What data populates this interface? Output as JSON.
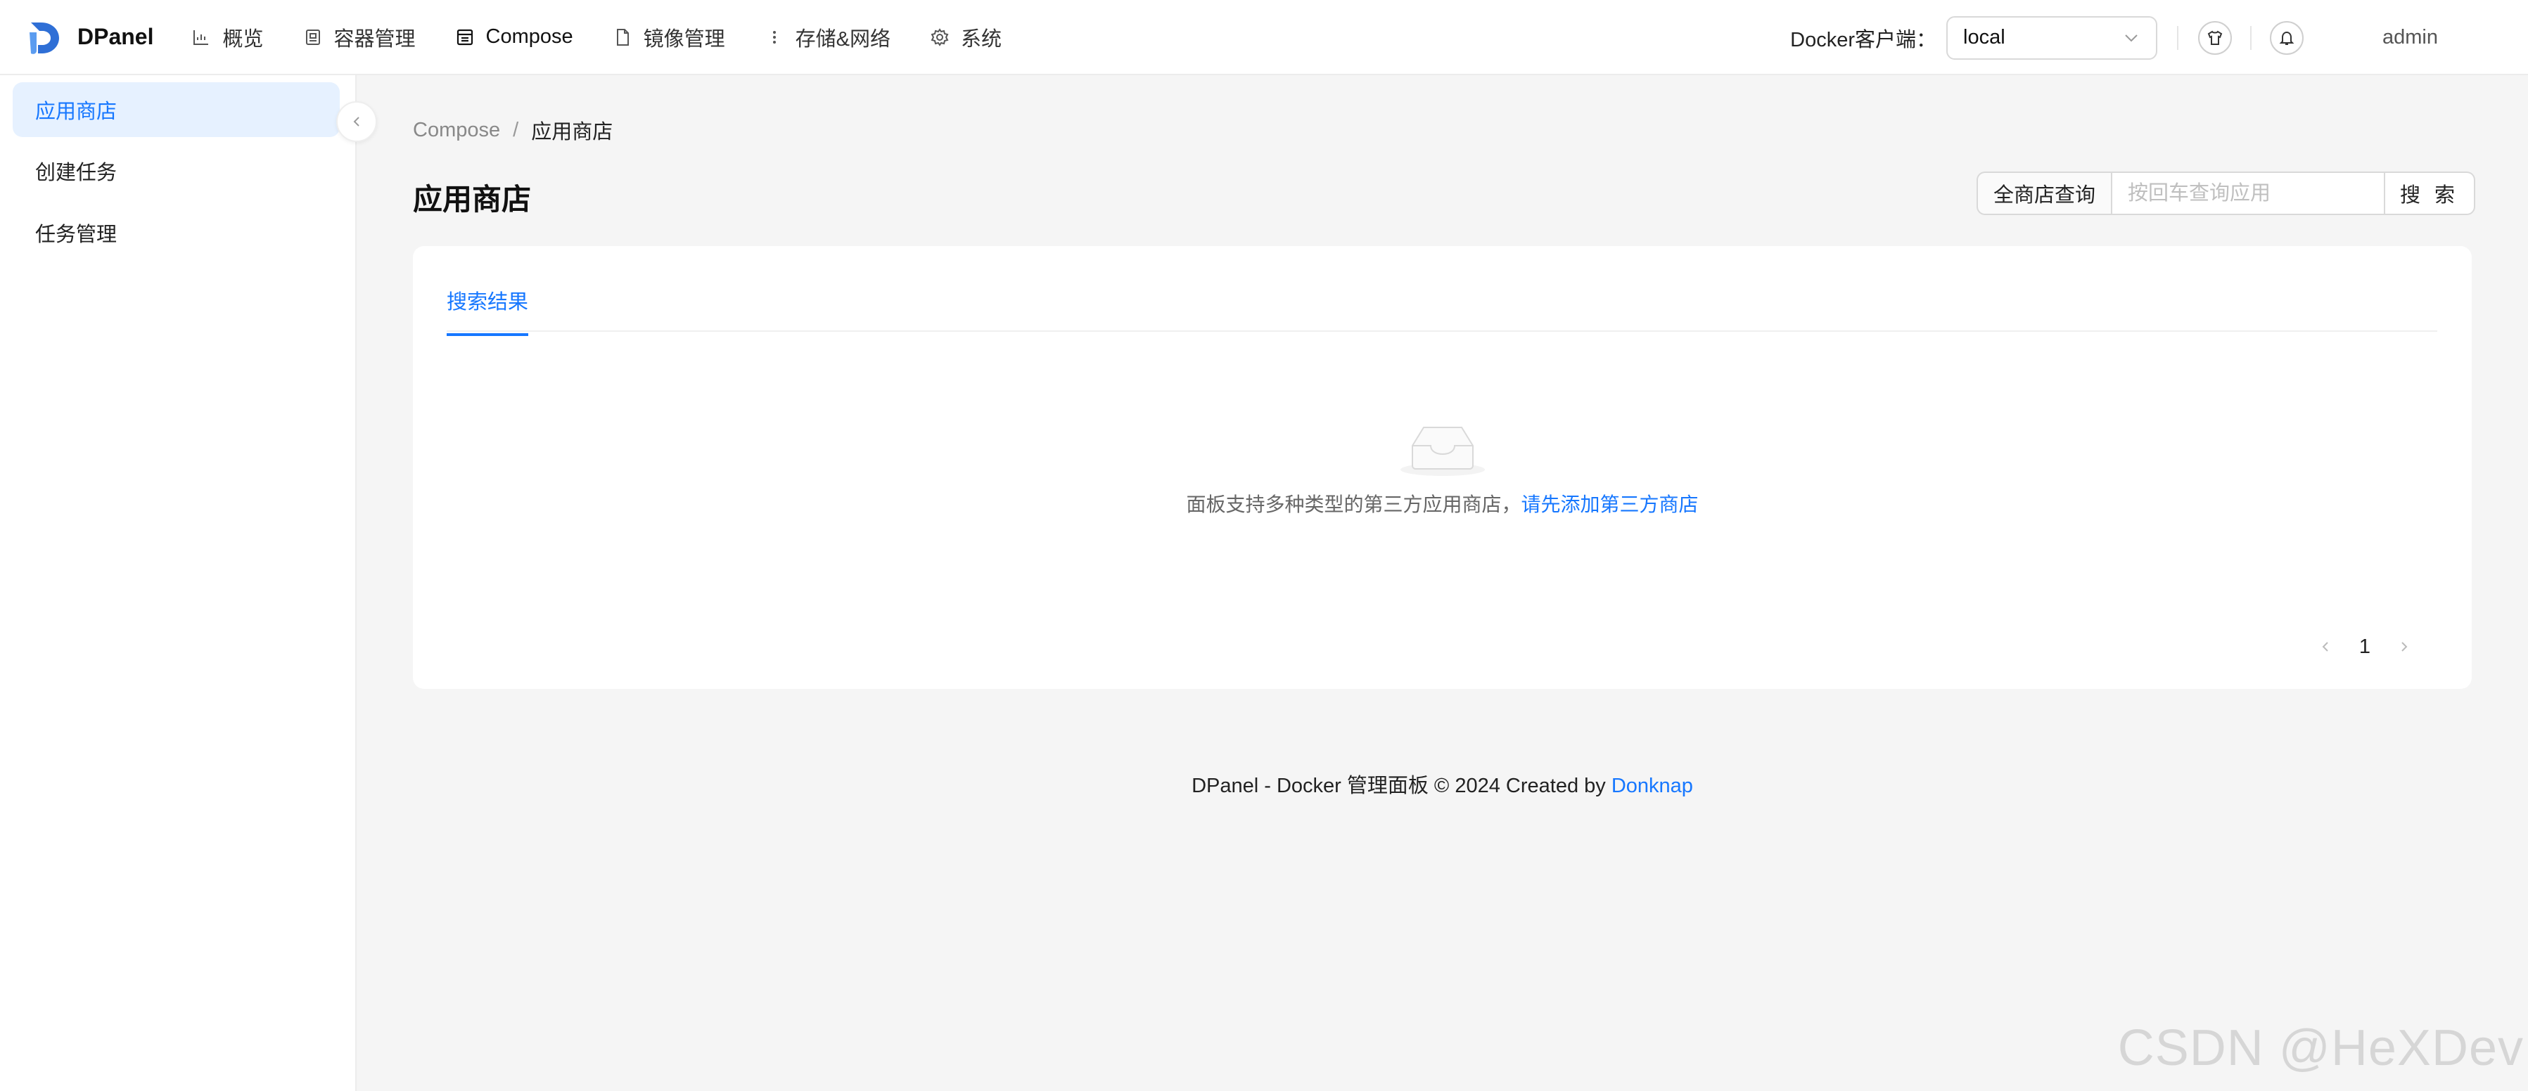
{
  "app": {
    "name": "DPanel"
  },
  "nav": {
    "items": [
      {
        "label": "概览",
        "icon": "chart-icon"
      },
      {
        "label": "容器管理",
        "icon": "container-icon"
      },
      {
        "label": "Compose",
        "icon": "compose-icon"
      },
      {
        "label": "镜像管理",
        "icon": "file-icon"
      },
      {
        "label": "存储&网络",
        "icon": "more-vertical-icon"
      },
      {
        "label": "系统",
        "icon": "gear-icon"
      }
    ]
  },
  "header": {
    "docker_label": "Docker客户端：",
    "docker_value": "local",
    "user": "admin"
  },
  "sidebar": {
    "items": [
      {
        "label": "应用商店",
        "active": true
      },
      {
        "label": "创建任务",
        "active": false
      },
      {
        "label": "任务管理",
        "active": false
      }
    ]
  },
  "breadcrumb": {
    "parent": "Compose",
    "separator": "/",
    "current": "应用商店"
  },
  "page": {
    "title": "应用商店"
  },
  "search": {
    "addon": "全商店查询",
    "placeholder": "按回车查询应用",
    "button": "搜 索"
  },
  "tabs": [
    {
      "label": "搜索结果"
    }
  ],
  "empty": {
    "text": "面板支持多种类型的第三方应用商店，",
    "link": "请先添加第三方商店"
  },
  "pagination": {
    "current": "1"
  },
  "footer": {
    "text": "DPanel - Docker 管理面板 © 2024 Created by ",
    "link": "Donknap"
  },
  "watermark": "CSDN @HeXDev",
  "colors": {
    "accent": "#1677ff",
    "active_bg": "#e6f1ff",
    "page_bg": "#f5f5f5"
  }
}
